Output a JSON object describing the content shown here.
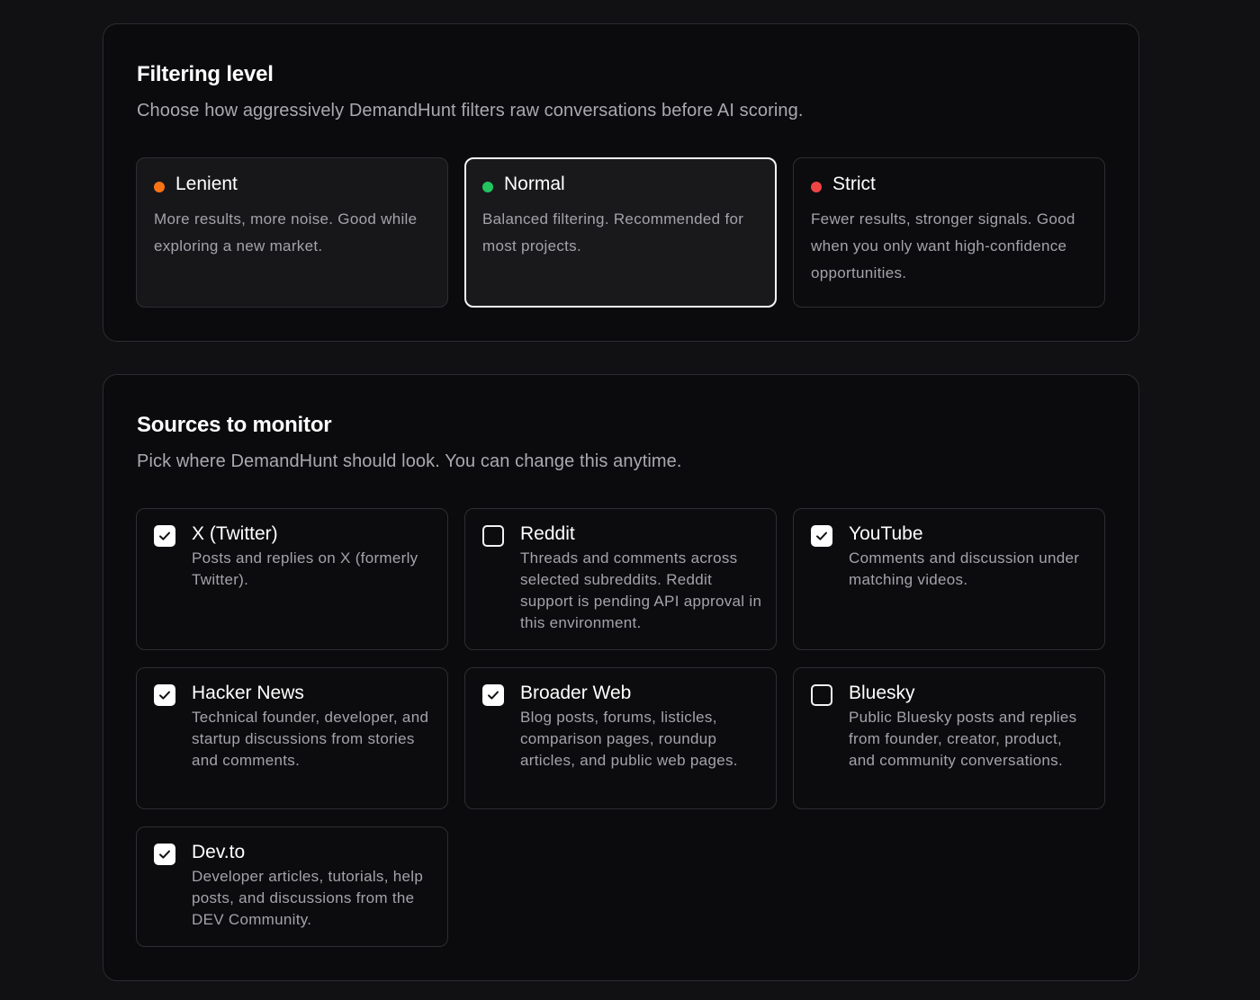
{
  "filtering": {
    "title": "Filtering level",
    "subtitle": "Choose how aggressively DemandHunt filters raw conversations before AI scoring.",
    "levels": [
      {
        "name": "Lenient",
        "description": "More results, more noise. Good while exploring a new market.",
        "dot_color": "#f97316",
        "selected": false
      },
      {
        "name": "Normal",
        "description": "Balanced filtering. Recommended for most projects.",
        "dot_color": "#22c55e",
        "selected": true
      },
      {
        "name": "Strict",
        "description": "Fewer results, stronger signals. Good when you only want high-confidence opportunities.",
        "dot_color": "#ef4444",
        "selected": false
      }
    ]
  },
  "sources": {
    "title": "Sources to monitor",
    "subtitle": "Pick where DemandHunt should look. You can change this anytime.",
    "items": [
      {
        "name": "X (Twitter)",
        "description": "Posts and replies on X (formerly Twitter).",
        "checked": true
      },
      {
        "name": "Reddit",
        "description": "Threads and comments across selected subreddits. Reddit support is pending API approval in this environment.",
        "checked": false
      },
      {
        "name": "YouTube",
        "description": "Comments and discussion under matching videos.",
        "checked": true
      },
      {
        "name": "Hacker News",
        "description": "Technical founder, developer, and startup discussions from stories and comments.",
        "checked": true
      },
      {
        "name": "Broader Web",
        "description": "Blog posts, forums, listicles, comparison pages, roundup articles, and public web pages.",
        "checked": true
      },
      {
        "name": "Bluesky",
        "description": "Public Bluesky posts and replies from founder, creator, product, and community conversations.",
        "checked": false
      },
      {
        "name": "Dev.to",
        "description": "Developer articles, tutorials, help posts, and discussions from the DEV Community.",
        "checked": true
      }
    ]
  }
}
